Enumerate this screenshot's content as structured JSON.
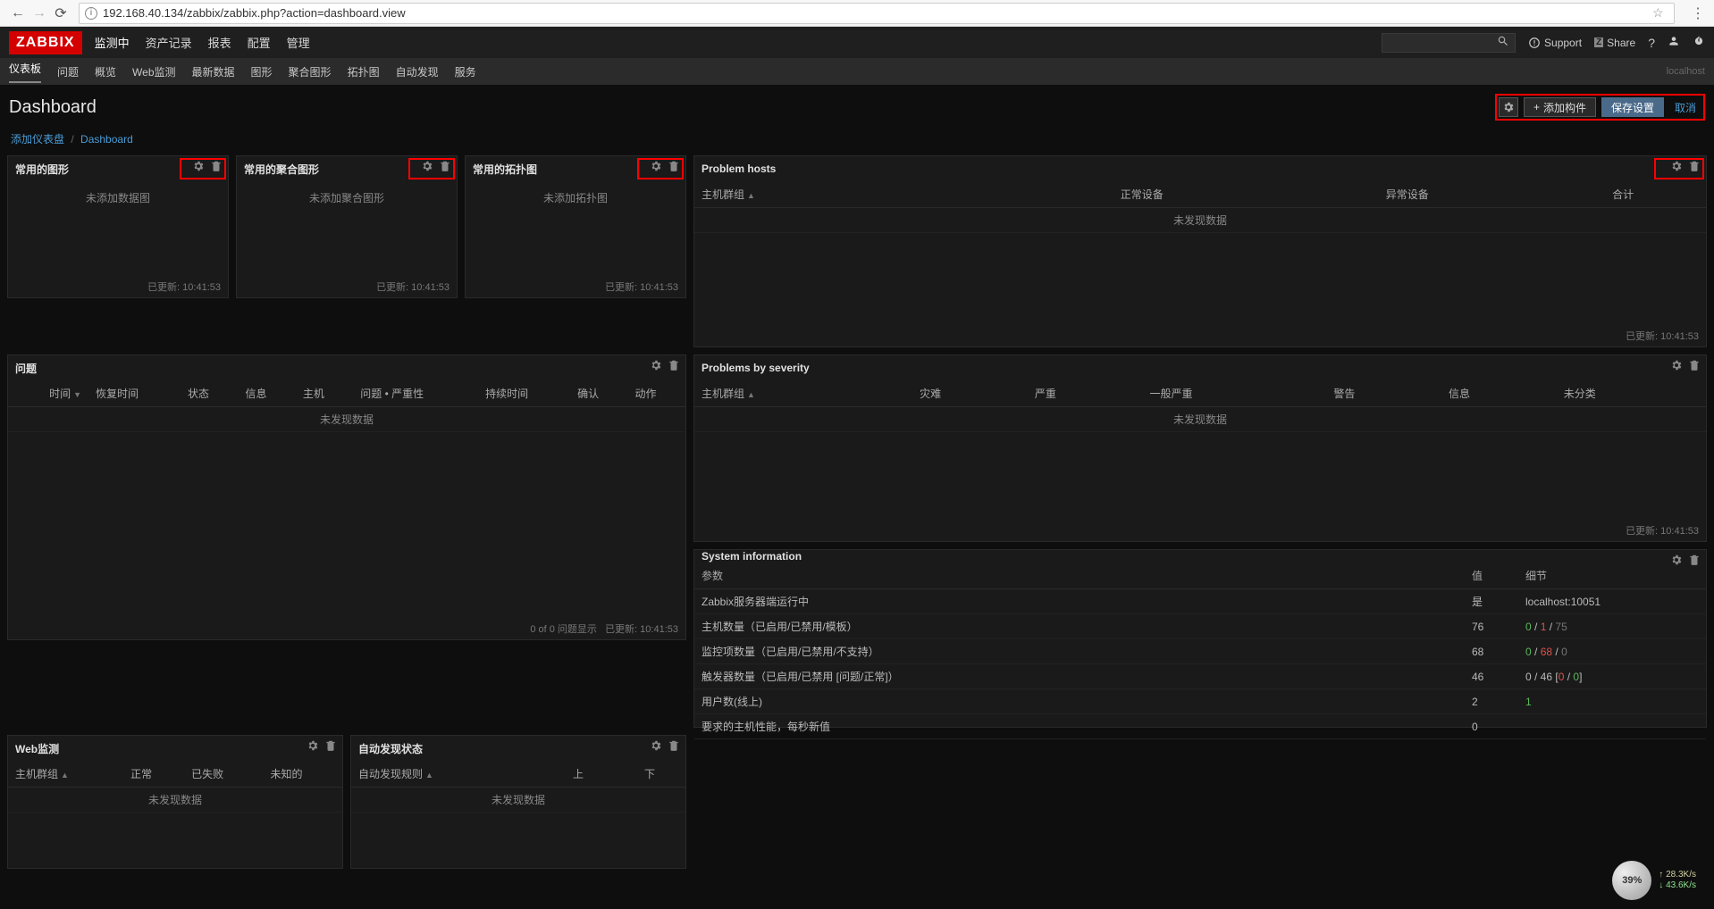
{
  "browser": {
    "url": "192.168.40.134/zabbix/zabbix.php?action=dashboard.view"
  },
  "header": {
    "logo": "ZABBIX",
    "menu": [
      "监测中",
      "资产记录",
      "报表",
      "配置",
      "管理"
    ],
    "active_menu": 0,
    "support": "Support",
    "share": "Share"
  },
  "submenu": {
    "items": [
      "仪表板",
      "问题",
      "概览",
      "Web监测",
      "最新数据",
      "图形",
      "聚合图形",
      "拓扑图",
      "自动发现",
      "服务"
    ],
    "active": 0,
    "right": "localhost"
  },
  "page": {
    "title": "Dashboard",
    "add_widget": "添加构件",
    "save": "保存设置",
    "cancel": "取消"
  },
  "breadcrumb": {
    "root": "添加仪表盘",
    "current": "Dashboard"
  },
  "widgets": {
    "fav_graphs": {
      "title": "常用的图形",
      "empty": "未添加数据图",
      "footer": "已更新: 10:41:53"
    },
    "fav_screens": {
      "title": "常用的聚合图形",
      "empty": "未添加聚合图形",
      "footer": "已更新: 10:41:53"
    },
    "fav_maps": {
      "title": "常用的拓扑图",
      "empty": "未添加拓扑图",
      "footer": "已更新: 10:41:53"
    },
    "problem_hosts": {
      "title": "Problem hosts",
      "cols": [
        "主机群组",
        "正常设备",
        "异常设备",
        "合计"
      ],
      "empty": "未发现数据",
      "footer": "已更新: 10:41:53"
    },
    "problems": {
      "title": "问题",
      "cols": [
        "时间",
        "恢复时间",
        "状态",
        "信息",
        "主机",
        "问题 • 严重性",
        "持续时间",
        "确认",
        "动作"
      ],
      "empty": "未发现数据",
      "footer_left": "0 of 0 问题显示",
      "footer": "已更新: 10:41:53"
    },
    "severity": {
      "title": "Problems by severity",
      "cols": [
        "主机群组",
        "灾难",
        "严重",
        "一般严重",
        "警告",
        "信息",
        "未分类"
      ],
      "empty": "未发现数据",
      "footer": "已更新: 10:41:53"
    },
    "webmon": {
      "title": "Web监测",
      "cols": [
        "主机群组",
        "正常",
        "已失败",
        "未知的"
      ],
      "empty": "未发现数据"
    },
    "discovery": {
      "title": "自动发现状态",
      "cols": [
        "自动发现规则",
        "上",
        "下"
      ],
      "empty": "未发现数据"
    },
    "sysinfo": {
      "title": "System information",
      "cols": [
        "参数",
        "值",
        "细节"
      ],
      "rows": [
        {
          "param": "Zabbix服务器端运行中",
          "value": "是",
          "value_class": "green",
          "detail": "localhost:10051"
        },
        {
          "param": "主机数量（已启用/已禁用/模板）",
          "value": "76",
          "detail_html": "<span class='green'>0</span> / <span class='red'>1</span> / <span class='grey'>75</span>"
        },
        {
          "param": "监控项数量（已启用/已禁用/不支持）",
          "value": "68",
          "detail_html": "<span class='green'>0</span> / <span class='red'>68</span> / <span class='grey'>0</span>"
        },
        {
          "param": "触发器数量（已启用/已禁用 [问题/正常]）",
          "value": "46",
          "detail_html": "0 / 46 [<span class='red'>0</span> / <span class='green'>0</span>]"
        },
        {
          "param": "用户数(线上)",
          "value": "2",
          "detail_html": "<span class='green'>1</span>"
        },
        {
          "param": "要求的主机性能，每秒新值",
          "value": "0",
          "detail": ""
        }
      ]
    }
  },
  "net": {
    "pct": "39%",
    "up": "28.3K/s",
    "dn": "43.6K/s"
  }
}
